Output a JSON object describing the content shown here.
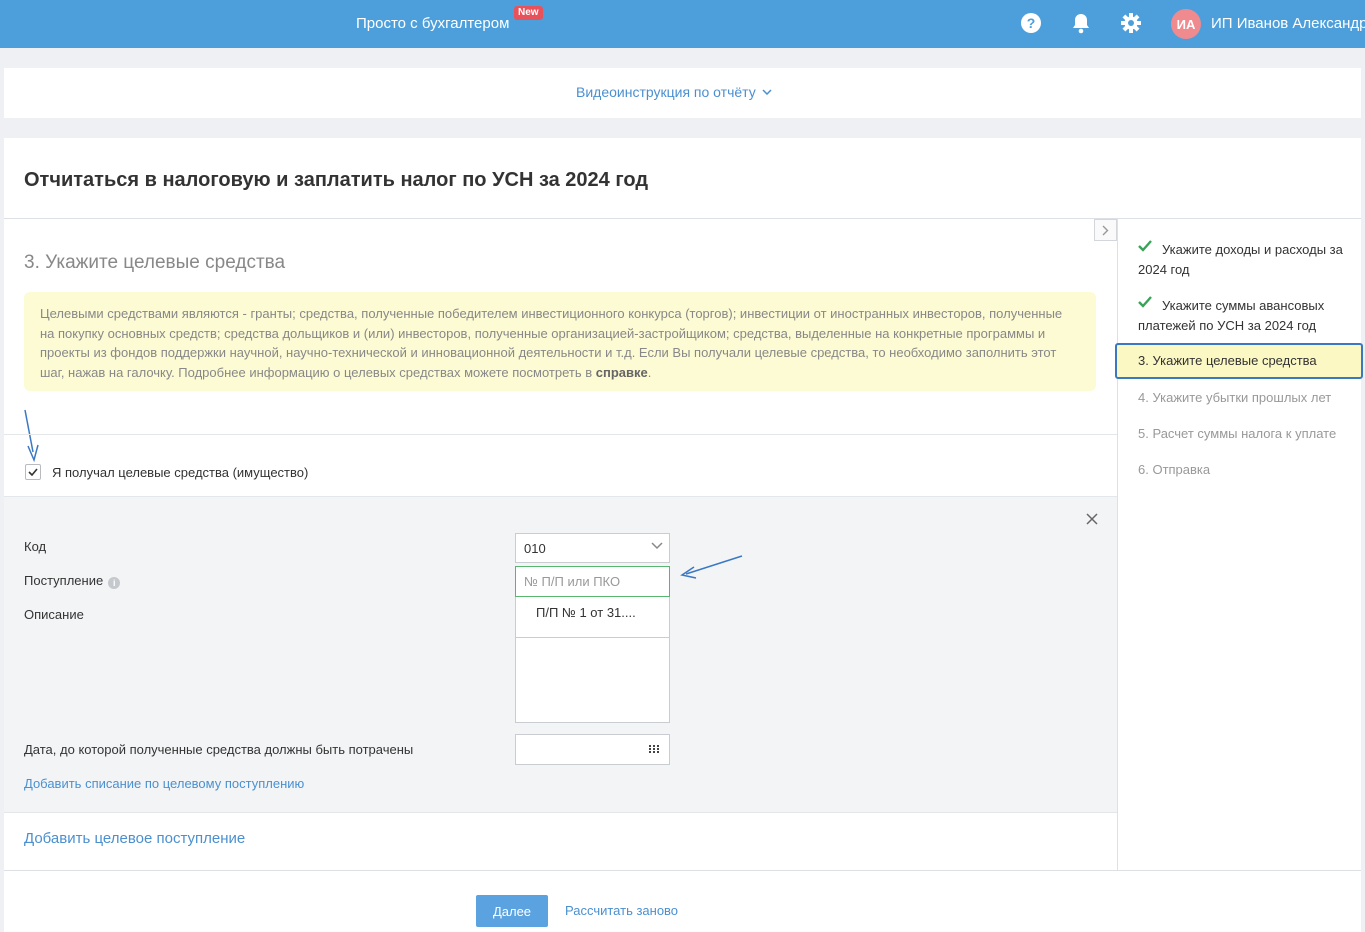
{
  "header": {
    "brand": "Просто с бухгалтером",
    "badge": "New",
    "avatar_initials": "ИА",
    "user_name": "ИП Иванов Александр"
  },
  "video_bar": {
    "link_label": "Видеоинструкция по отчёту"
  },
  "page": {
    "title": "Отчитаться в налоговую и заплатить налог по УСН за 2024 год",
    "step_heading": "3. Укажите целевые средства",
    "info_text": "Целевыми средствами являются - гранты; средства, полученные победителем инвестиционного конкурса (торгов); инвестиции от иностранных инвесторов, полученные на покупку основных средств; средства дольщиков и (или) инвесторов, полученные организацией-застройщиком; средства, выделенные на конкретные программы и проекты из фондов поддержки научной, научно-технической и инновационной деятельности и т.д. Если Вы получали целевые средства, то необходимо заполнить этот шаг, нажав на галочку. Подробнее информацию о целевых средствах можете посмотреть в ",
    "info_link": "справке",
    "info_end": ".",
    "checkbox_label": "Я получал целевые средства (имущество)"
  },
  "form": {
    "code_label": "Код",
    "code_value": "010",
    "receipt_label": "Поступление",
    "receipt_placeholder": "№ П/П или ПКО",
    "receipt_suggestion": "П/П № 1 от 31....",
    "description_label": "Описание",
    "date_label": "Дата, до которой полученные средства должны быть потрачены",
    "add_writeoff": "Добавить списание по целевому поступлению"
  },
  "add_target": "Добавить целевое поступление",
  "actions": {
    "next": "Далее",
    "recalc": "Рассчитать заново"
  },
  "steps": [
    {
      "label": "Укажите доходы и расходы за 2024 год",
      "state": "done"
    },
    {
      "label": "Укажите суммы авансовых платежей по УСН за 2024 год",
      "state": "done"
    },
    {
      "label": "3.  Укажите целевые средства",
      "state": "active"
    },
    {
      "label": "4.  Укажите убытки прошлых лет",
      "state": "todo"
    },
    {
      "label": "5.  Расчет суммы налога к уплате",
      "state": "todo"
    },
    {
      "label": "6.  Отправка",
      "state": "todo"
    }
  ],
  "colors": {
    "header": "#4d9fdb",
    "accent": "#4a90d0",
    "done_check": "#3aa35a",
    "active_border": "#3b78c4",
    "info_bg": "#fdfbd3"
  }
}
